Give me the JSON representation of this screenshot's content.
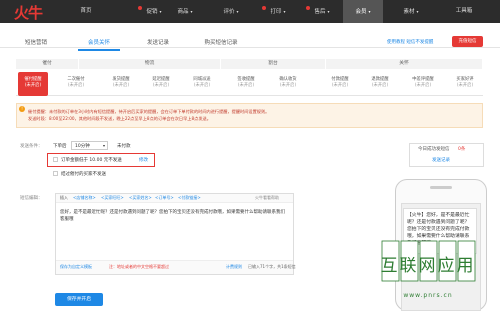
{
  "logo": {
    "text": "火牛"
  },
  "topnav": {
    "items": [
      {
        "label": "首页",
        "caret": false,
        "dot": false
      },
      {
        "label": "促销",
        "caret": true,
        "dot": true
      },
      {
        "label": "商品",
        "caret": true,
        "dot": false
      },
      {
        "label": "评价",
        "caret": true,
        "dot": false
      },
      {
        "label": "打印",
        "caret": true,
        "dot": true
      },
      {
        "label": "售后",
        "caret": true,
        "dot": true
      },
      {
        "label": "会员",
        "caret": true,
        "dot": false,
        "active": true
      },
      {
        "label": "素材",
        "caret": true,
        "dot": false
      },
      {
        "label": "工具箱",
        "caret": false,
        "dot": false
      }
    ]
  },
  "subnav": {
    "items": [
      "短信营销",
      "会员关怀",
      "发送记录",
      "购买短信记录"
    ],
    "active_index": 1,
    "tutorial_link": "使用教程  短信不发提醒",
    "sms_button": "充值短信"
  },
  "categories": [
    "催付",
    "物流",
    "割台",
    "关怀"
  ],
  "subtabs": [
    {
      "label": "催付提醒",
      "status": "(未开启)",
      "active": true
    },
    {
      "label": "二次催付",
      "status": "(未开启)"
    },
    {
      "label": "发货提醒",
      "status": "(未开启)"
    },
    {
      "label": "延迟提醒",
      "status": "(未开启)"
    },
    {
      "label": "同城派送",
      "status": "(未开启)"
    },
    {
      "label": "签收提醒",
      "status": "(未开启)"
    },
    {
      "label": "确认收货",
      "status": "(未开启)"
    },
    {
      "label": "付款提醒",
      "status": "(未开启)"
    },
    {
      "label": "退款提醒",
      "status": "(未开启)"
    },
    {
      "label": "中差评提醒",
      "status": "(未开启)"
    },
    {
      "label": "买家好评",
      "status": "(未开启)"
    }
  ],
  "notice": {
    "line1": "催付提醒：未付款的订单在3小时内有短信提醒，待开启后买家的提醒，会在订单下单付款的时间内进行提醒，提醒时间设置规则。",
    "line2": "发送时段：8:00至22:00，其他时间段不发送，晚上22点至早上8点的订单会在次日早上8点发送。"
  },
  "form": {
    "cond_label": "发送条件：",
    "after_order": "下单后",
    "minutes": "10分钟",
    "unpaid": "未付款",
    "amount_text": "订单金额低于 10.00 元不发送",
    "modify_link": "修改",
    "exclude_text": "结过催付的买家不发送",
    "content_label": "短信编辑：",
    "toolbar": [
      "插入",
      "<店铺名称>",
      "<买家旺旺>",
      "<买家姓名>",
      "<订单号>",
      "<付款链接>"
    ],
    "preview_link": "火牛看看帮助",
    "content": "您好，是不是最近忙呢？还是付款遇到问题了呢？您拍下的宝贝还没有完成付款哦，如果需要什么帮助请联系我们客服哦",
    "footer_left": "保存为自定义模板",
    "footer_note": "注：地址或者的中文空格不要超过",
    "footer_count": "计费规则",
    "footer_chars": "已输入71个字，共1条短信",
    "save_button": "保存并开启"
  },
  "sent_panel": {
    "title": "今日成功发短信",
    "count": "0条",
    "link": "发送记录"
  },
  "phone": {
    "message": "【火牛】您好，是不是最近忙呢？还是付款遇到问题了呢？您拍下的宝贝还没有完成付款哦，如果需要什么帮助请联系我们客服哦"
  },
  "watermark": {
    "big": "互联网应用",
    "small": "www.pnrs.cn"
  },
  "colors": {
    "accent": "#1e88e5",
    "brand": "#e53935",
    "topbar": "#2c2c2c"
  }
}
